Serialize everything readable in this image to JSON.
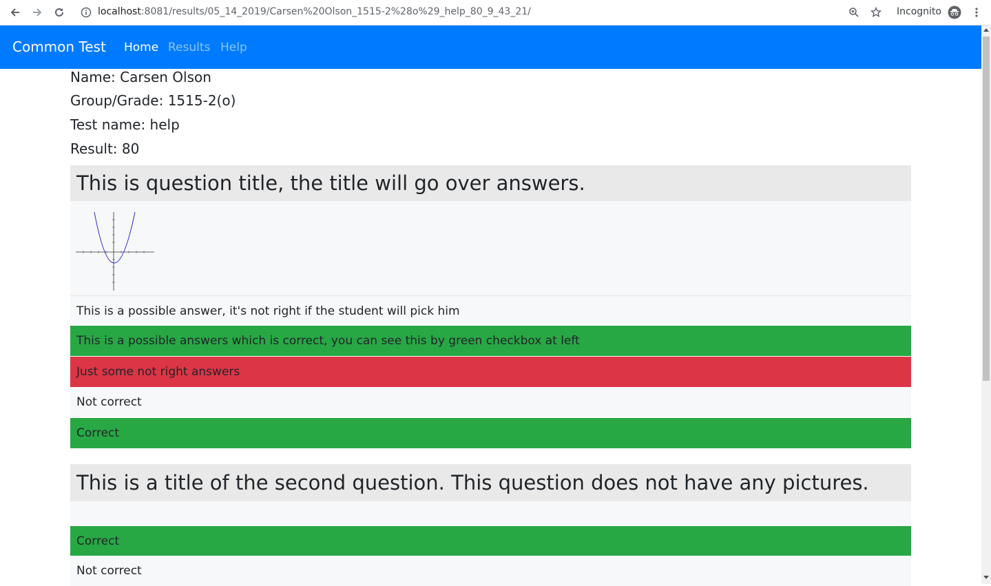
{
  "browser": {
    "url_host": "localhost",
    "url_rest": ":8081/results/05_14_2019/Carsen%20Olson_1515-2%28o%29_help_80_9_43_21/",
    "incognito_label": "Incognito"
  },
  "navbar": {
    "brand": "Common Test",
    "links": [
      "Home",
      "Results",
      "Help"
    ]
  },
  "info": {
    "name": "Name: Carsen Olson",
    "group": "Group/Grade: 1515-2(o)",
    "test_name": "Test name: help",
    "result": "Result: 80"
  },
  "questions": [
    {
      "title": "This is question title, the title will go over answers.",
      "image": "parabola-graph",
      "answers": [
        {
          "text": "This is a possible answer, it's not right if the student will pick him",
          "status": "neutral"
        },
        {
          "text": "This is a possible answers which is correct, you can see this by green checkbox at left",
          "status": "correct"
        },
        {
          "text": "Just some not right answers",
          "status": "wrong"
        },
        {
          "text": "Not correct",
          "status": "neutral"
        },
        {
          "text": "Correct",
          "status": "correct"
        }
      ]
    },
    {
      "title": "This is a title of the second question. This question does not have any pictures.",
      "answers": [
        {
          "text": "Correct",
          "status": "correct"
        },
        {
          "text": "Not correct",
          "status": "neutral"
        }
      ]
    }
  ],
  "colors": {
    "navbar": "#007bff",
    "correct": "#28a745",
    "wrong": "#dc3545",
    "neutral": "#f7f8fa",
    "title_bg": "#e9e9e9"
  }
}
